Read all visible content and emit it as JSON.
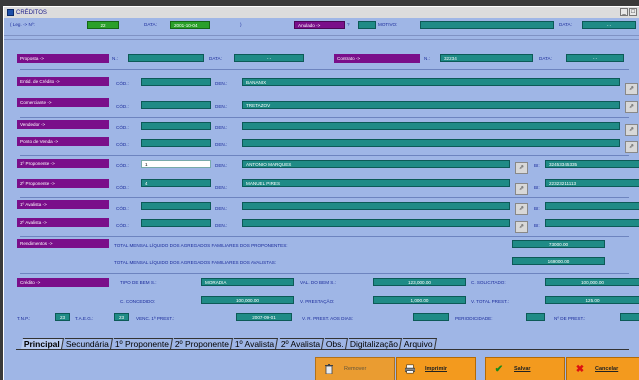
{
  "window": {
    "title": "CRÉDITOS",
    "ctrl_min": "_",
    "ctrl_close": "□"
  },
  "header": {
    "leg_label": "( Leg. -> Nº:",
    "leg_number": "22",
    "data_label": "DATA:",
    "data_value": "2001-10-04",
    "paren_close": ")",
    "status": "Anulado ->",
    "status_q": "?",
    "status_field": "",
    "motivo_label": "MOTIVO:",
    "motivo_value": "",
    "data2_label": "DATA:",
    "data2_value": "- -"
  },
  "proposta": {
    "label": "Proposta ->",
    "n_label": "N.:",
    "n_value": "",
    "data_label": "DATA:",
    "data_value": "- -",
    "contrato_label": "Contrato ->",
    "contrato_n_label": "N.:",
    "contrato_n_value": "32234",
    "contrato_data_label": "DATA:",
    "contrato_data_value": "- -"
  },
  "entidades": [
    {
      "label": "Entid. de Crédito ->",
      "cod_label": "CÓD.:",
      "cod": "",
      "den_label": "DEN.:",
      "den": "BANANIX"
    },
    {
      "label": "Comerciante ->",
      "cod_label": "CÓD.:",
      "cod": "",
      "den_label": "DEN.:",
      "den": "TRETAZOV"
    },
    {
      "label": "Vendedor ->",
      "cod_label": "CÓD.:",
      "cod": "",
      "den_label": "DEN.:",
      "den": ""
    },
    {
      "label": "Ponto de Venda ->",
      "cod_label": "CÓD.:",
      "cod": "",
      "den_label": "DEN.:",
      "den": ""
    }
  ],
  "pessoas": [
    {
      "label": "1º Proponente ->",
      "cod_label": "CÓD.:",
      "cod": "1",
      "den_label": "DEN.:",
      "den": "ANTONIO MARQUES",
      "bi_label": "BI:",
      "bi": "32453345335"
    },
    {
      "label": "2º Proponente ->",
      "cod_label": "CÓD.:",
      "cod": "4",
      "den_label": "DEN.:",
      "den": "MANUEL PIRES",
      "bi_label": "BI:",
      "bi": "22323211113"
    },
    {
      "label": "1º Avalista ->",
      "cod_label": "CÓD.:",
      "cod": "",
      "den_label": "DEN.:",
      "den": "",
      "bi_label": "BI:",
      "bi": ""
    },
    {
      "label": "2º Avalista ->",
      "cod_label": "CÓD.:",
      "cod": "",
      "den_label": "DEN.:",
      "den": "",
      "bi_label": "BI:",
      "bi": ""
    }
  ],
  "rendimentos": {
    "label": "Rendimentos ->",
    "line1": "TOTAL MENSAL LÍQUIDO DOS AGREGADOS FAMILIARES DOS PROPONENTES:",
    "value1": "73000.00",
    "line2": "TOTAL MENSAL LÍQUIDO DOS AGREGADOS FAMILIARES DOS AVALISTAS:",
    "value2": "169000.00"
  },
  "credito": {
    "label": "Crédito ->",
    "tipo_label": "TIPO DE BEM S.:",
    "tipo": "MORADIA",
    "val_bem_label": "VAL. DO BEM S.:",
    "val_bem": "123,000.00",
    "solicitado_label": "C. SOLICITADO:",
    "solicitado": "100,000.00",
    "concedido_label": "C. CONCEDIDO:",
    "concedido": "100,000.00",
    "prestacao_label": "V. PRESTAÇÃO:",
    "prestacao": "1,000.00",
    "total_prest_label": "V. TOTAL PREST.:",
    "total_prest": "125.00",
    "tnp_label": "T.N.P.:",
    "tnp": "23",
    "taeg_label": "T.A.E.G.:",
    "taeg": "23",
    "venc_label": "VENC. 1ª PREST.:",
    "venc": "2007-09-01",
    "vr_prest_label": "V. R. PREST. AOS DIAS:",
    "vr_prest": "",
    "periodicidade_label": "PERIODICIDADE:",
    "periodicidade": "",
    "n_prest_label": "Nº DE PREST.:",
    "n_prest": ""
  },
  "pick_glyph": "⇗",
  "tabs": [
    "Principal",
    "Secundária",
    "1º Proponente",
    "2º Proponente",
    "1º Avalista",
    "2º Avalista",
    "Obs.",
    "Digitalização",
    "Arquivo"
  ],
  "buttons": {
    "remover": "Remover",
    "imprimir": "Imprimir",
    "salvar": "Salvar",
    "cancelar": "Cancelar"
  },
  "colors": {
    "field": "#1f8b86",
    "label_bg": "#7a0f8a",
    "bg": "#9fb6e6",
    "button": "#f39a1e"
  }
}
